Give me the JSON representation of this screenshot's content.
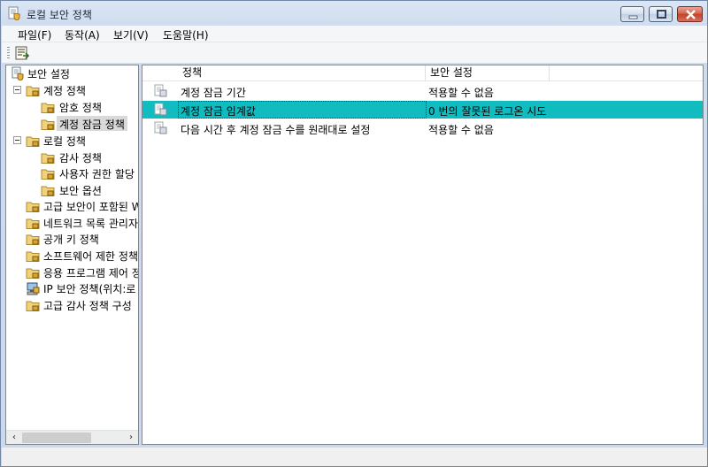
{
  "window": {
    "title": "로컬 보안 정책"
  },
  "menu": {
    "file": "파일(F)",
    "action": "동작(A)",
    "view": "보기(V)",
    "help": "도움말(H)"
  },
  "toolbar": {
    "export_icon": "export-list-icon"
  },
  "tree": {
    "root": "보안 설정",
    "account_policy": "계정 정책",
    "password_policy": "암호 정책",
    "lockout_policy": "계정 잠금 정책",
    "local_policy": "로컬 정책",
    "audit_policy": "감사 정책",
    "user_rights": "사용자 권한 할당",
    "security_options": "보안 옵션",
    "advanced_firewall": "고급 보안이 포함된 W",
    "network_list": "네트워크 목록 관리자",
    "public_key": "공개 키 정책",
    "software_restriction": "소프트웨어 제한 정책",
    "app_control": "응용 프로그램 제어 정",
    "ip_security": "IP 보안 정책(위치:로",
    "advanced_audit": "고급 감사 정책 구성"
  },
  "list": {
    "columns": [
      "정책",
      "보안 설정"
    ],
    "rows": [
      {
        "policy": "계정 잠금 기간",
        "setting": "적용할 수 없음"
      },
      {
        "policy": "계정 잠금 임계값",
        "setting": "0 번의 잘못된 로그온 시도"
      },
      {
        "policy": "다음 시간 후 계정 잠금 수를 원래대로 설정",
        "setting": "적용할 수 없음"
      }
    ],
    "selected_index": 1
  },
  "colors": {
    "selection": "#11bcc0",
    "tree_selection": "#d9d9d9"
  }
}
